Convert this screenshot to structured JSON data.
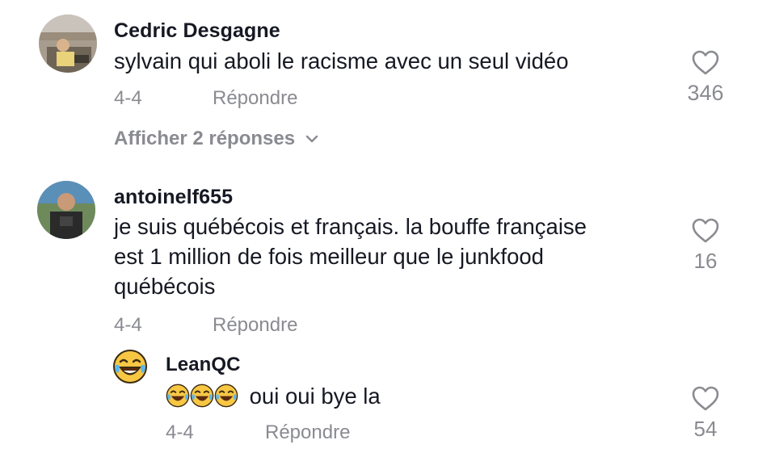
{
  "comments": [
    {
      "username": "Cedric Desgagne",
      "text": "sylvain qui aboli le racisme avec un seul vidéo",
      "date": "4-4",
      "reply_label": "Répondre",
      "likes": "346",
      "view_replies_label": "Afficher 2 réponses",
      "avatar_icon": "photo-avatar-icon"
    },
    {
      "username": "antoinelf655",
      "text_lines": [
        "je suis québécois et français. la bouffe française",
        "est 1 million de fois meilleur que le junkfood",
        "québécois"
      ],
      "date": "4-4",
      "reply_label": "Répondre",
      "likes": "16",
      "avatar_icon": "photo-avatar-icon"
    }
  ],
  "reply": {
    "username": "LeanQC",
    "emoji_prefix": "😂😂😂",
    "text": "oui oui bye la",
    "date": "4-4",
    "reply_label": "Répondre",
    "likes": "54",
    "avatar_icon": "laughing-tears-emoji-icon"
  },
  "colors": {
    "text": "#161823",
    "muted": "#8a8b91",
    "emoji_yellow": "#f7c744"
  }
}
